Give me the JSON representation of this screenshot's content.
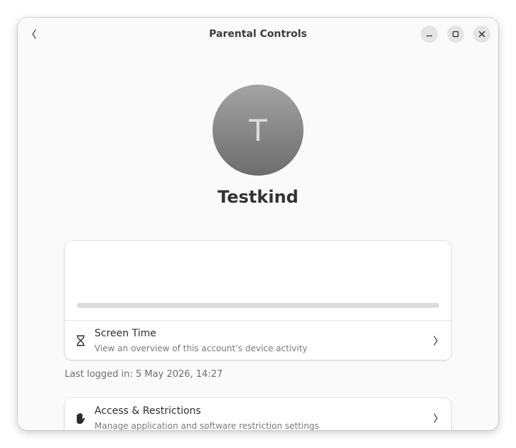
{
  "window": {
    "title": "Parental Controls"
  },
  "header": {
    "back_icon": "chevron-left-icon",
    "minimize_icon": "minimize-icon",
    "maximize_icon": "maximize-icon",
    "close_icon": "close-icon"
  },
  "user": {
    "initial": "T",
    "name": "Testkind"
  },
  "screen_time": {
    "usage_fraction": 0,
    "title": "Screen Time",
    "subtitle": "View an overview of this account’s device activity",
    "icon": "hourglass-icon"
  },
  "last_login": "Last logged in: 5 May 2026, 14:27",
  "access": {
    "title": "Access & Restrictions",
    "subtitle": "Manage application and software restriction settings",
    "icon": "hand-icon"
  },
  "colors": {
    "window_bg": "#fafafa",
    "card_bg": "#ffffff",
    "accent": "#3584e4"
  }
}
